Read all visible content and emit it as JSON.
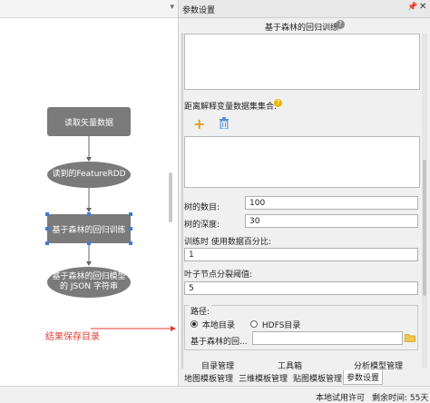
{
  "canvas": {
    "nodes": {
      "load": "读取矢量数据",
      "to_rdd": "读到的FeatureRDD",
      "rf": "基于森林的回归训练",
      "model": "基于森林的回归模型",
      "model_json": "的 JSON 字符串"
    },
    "annotation": "结果保存目录",
    "annotation_color": "#e53935"
  },
  "panel": {
    "title": "参数设置",
    "section_title": "基于森林的回归训练",
    "dataset_label": "距离解释变量数据集集合:",
    "tree_count_label": "树的数目:",
    "tree_count": "100",
    "tree_depth_label": "树的深度:",
    "tree_depth": "30",
    "train_pct_label": "训练时 使用数据百分比:",
    "train_pct": "1",
    "leaf_split_label": "叶子节点分裂阈值:",
    "leaf_split": "5",
    "path_group": "路径:",
    "radio_local": "本地目录",
    "radio_hdfs": "HDFS目录",
    "path_label": "基于森林的回...",
    "path_value": ""
  },
  "tabs_row1": [
    "目录管理",
    "工具箱",
    "分析模型管理"
  ],
  "tabs_row2": [
    "地图模板管理",
    "三维模板管理",
    "贴图模板管理",
    "参数设置"
  ],
  "status": {
    "license": "本地试用许可",
    "remaining": "剩余时间: 55天"
  },
  "colors": {
    "accent": "#3c7cd6",
    "add_icon": "#e0a020",
    "node": "#7a7a7a"
  }
}
